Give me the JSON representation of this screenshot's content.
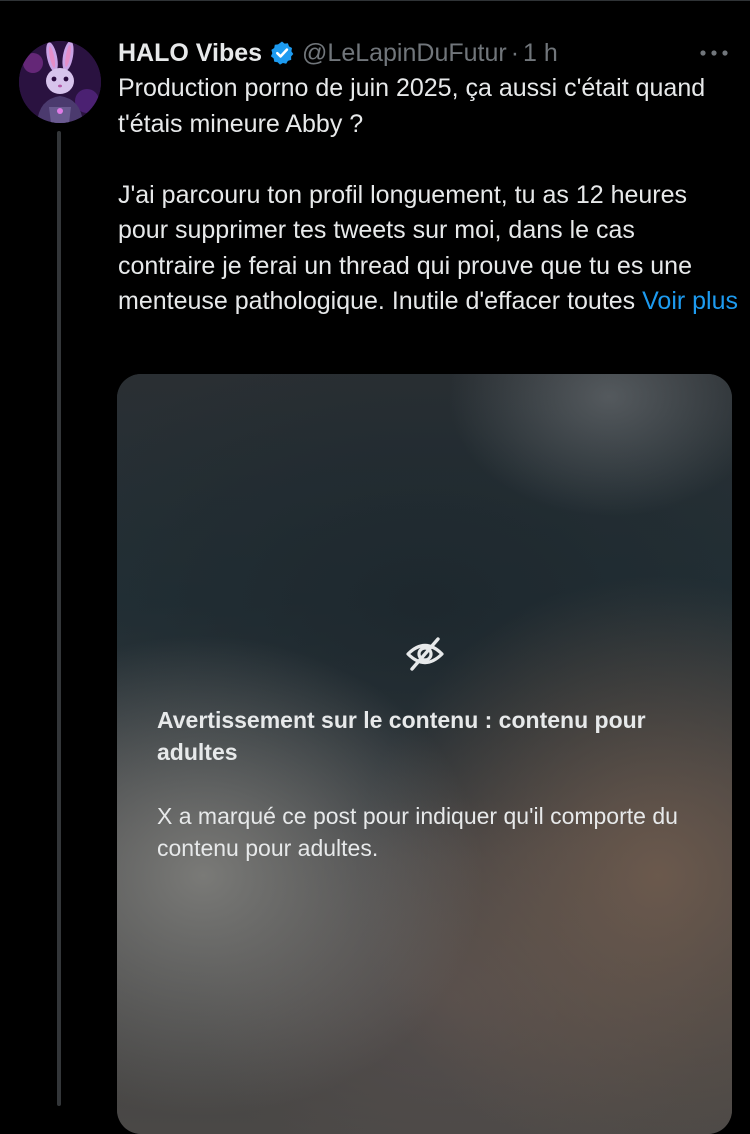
{
  "post": {
    "author": {
      "display_name": "HALO Vibes",
      "handle": "@LeLapinDuFutur",
      "verified": true,
      "avatar_icon": "rabbit-avatar-icon"
    },
    "separator": "·",
    "time": "1 h",
    "more_icon": "more-horizontal-icon",
    "text": "Production porno de juin 2025, ça aussi c'était quand t'étais mineure Abby ?\n\nJ'ai parcouru ton profil longuement, tu as 12 heures pour supprimer tes tweets sur moi, dans le cas contraire je ferai un thread qui prouve que tu es une menteuse pathologique. Inutile d'effacer toutes ",
    "see_more_label": "Voir plus",
    "media": {
      "warning_icon": "eye-slash-icon",
      "warning_title": "Avertissement sur le contenu : contenu pour adultes",
      "warning_description": "X a marqué ce post pour indiquer qu'il comporte du contenu pour adultes."
    }
  },
  "colors": {
    "background": "#000000",
    "text_primary": "#e7e9ea",
    "text_secondary": "#71767b",
    "link": "#1d9bf0",
    "verified_badge": "#1d9bf0",
    "thread_line": "#333639"
  }
}
